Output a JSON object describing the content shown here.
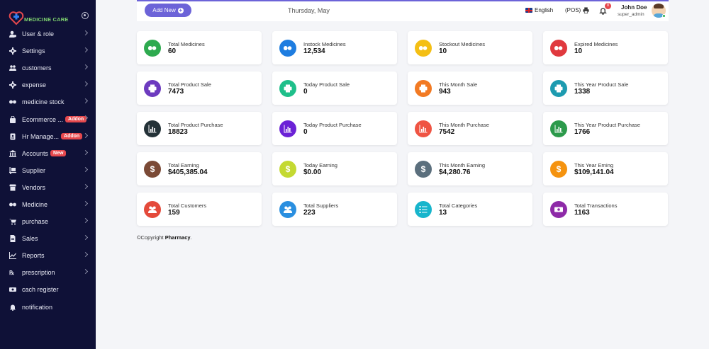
{
  "brand": {
    "name": "MEDICINE CARE"
  },
  "sidebar": {
    "items": [
      {
        "label": "User & role",
        "icon": "user-cog-icon",
        "tag": ""
      },
      {
        "label": "Settings",
        "icon": "gear-icon",
        "tag": ""
      },
      {
        "label": "customers",
        "icon": "users-icon",
        "tag": ""
      },
      {
        "label": "expense",
        "icon": "gear-icon",
        "tag": ""
      },
      {
        "label": "medicine stock",
        "icon": "pills-icon",
        "tag": ""
      },
      {
        "label": "Ecommerce ...",
        "icon": "bag-icon",
        "tag": "Addon"
      },
      {
        "label": "Hr Manage...",
        "icon": "id-badge-icon",
        "tag": "Addon"
      },
      {
        "label": "Accounts",
        "icon": "bank-icon",
        "tag": "New"
      },
      {
        "label": "Supplier",
        "icon": "dolly-icon",
        "tag": ""
      },
      {
        "label": "Vendors",
        "icon": "store-icon",
        "tag": ""
      },
      {
        "label": "Medicine",
        "icon": "pills-icon",
        "tag": ""
      },
      {
        "label": "purchase",
        "icon": "cart-icon",
        "tag": ""
      },
      {
        "label": "Sales",
        "icon": "file-icon",
        "tag": ""
      },
      {
        "label": "Reports",
        "icon": "chart-line-icon",
        "tag": ""
      },
      {
        "label": "prescription",
        "icon": "rx-icon",
        "tag": ""
      },
      {
        "label": "cach register",
        "icon": "cash-icon",
        "tag": ""
      },
      {
        "label": "notification",
        "icon": "bell-icon",
        "tag": ""
      }
    ]
  },
  "topbar": {
    "add_new_label": "Add New",
    "date": "Thursday, May",
    "language": "English",
    "pos_label": "(POS)",
    "notification_count": "0",
    "user_name": "John Doe",
    "user_role": "super_admin"
  },
  "cards": [
    {
      "label": "Total Medicines",
      "value": "60",
      "color": "#2eaa4f",
      "icon": "pills-icon"
    },
    {
      "label": "Instock Medicines",
      "value": "12,534",
      "color": "#1e7de0",
      "icon": "pills-icon"
    },
    {
      "label": "Stockout Medicines",
      "value": "10",
      "color": "#f4bf14",
      "icon": "pills-icon"
    },
    {
      "label": "Expired Medicines",
      "value": "10",
      "color": "#e0393e",
      "icon": "pills-icon"
    },
    {
      "label": "Total Product Sale",
      "value": "7473",
      "color": "#6d3bbf",
      "icon": "printer-icon"
    },
    {
      "label": "Today Product Sale",
      "value": "0",
      "color": "#1fbf8a",
      "icon": "printer-icon"
    },
    {
      "label": "This Month Sale",
      "value": "943",
      "color": "#f27a23",
      "icon": "printer-icon"
    },
    {
      "label": "This Year Product Sale",
      "value": "1338",
      "color": "#1d9bb0",
      "icon": "printer-icon"
    },
    {
      "label": "Total Product Purchase",
      "value": "18823",
      "color": "#243238",
      "icon": "bar-chart-icon"
    },
    {
      "label": "Today Product Purchase",
      "value": "0",
      "color": "#6b22d6",
      "icon": "bar-chart-icon"
    },
    {
      "label": "This Month Purchase",
      "value": "7542",
      "color": "#ef5443",
      "icon": "bar-chart-icon"
    },
    {
      "label": "This Year Product Purchase",
      "value": "1766",
      "color": "#2c9a4b",
      "icon": "bar-chart-icon"
    },
    {
      "label": "Total Earning",
      "value": "$405,385.04",
      "color": "#7b4a36",
      "icon": "dollar-icon"
    },
    {
      "label": "Today Earning",
      "value": "$0.00",
      "color": "#c4d932",
      "icon": "dollar-icon"
    },
    {
      "label": "This Month Earning",
      "value": "$4,280.76",
      "color": "#5b6f7d",
      "icon": "dollar-icon"
    },
    {
      "label": "This Year Erning",
      "value": "$109,141.04",
      "color": "#f5930f",
      "icon": "dollar-icon"
    },
    {
      "label": "Total Customers",
      "value": "159",
      "color": "#e44a3b",
      "icon": "users-icon"
    },
    {
      "label": "Total Suppliers",
      "value": "223",
      "color": "#2a8fe0",
      "icon": "users-icon"
    },
    {
      "label": "Total Categories",
      "value": "13",
      "color": "#17b5cc",
      "icon": "list-icon"
    },
    {
      "label": "Total Transactions",
      "value": "1163",
      "color": "#8e2aa8",
      "icon": "money-icon"
    }
  ],
  "footer": {
    "prefix": "©Copyright ",
    "brand": "Pharmacy",
    "suffix": "."
  }
}
